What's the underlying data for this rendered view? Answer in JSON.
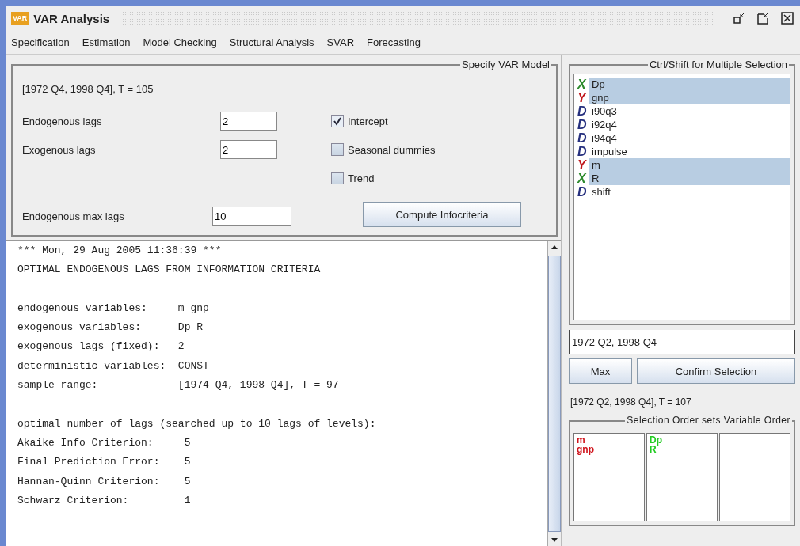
{
  "window": {
    "title": "VAR Analysis",
    "logo": "VAR"
  },
  "menu": [
    {
      "label": "Specification",
      "underlined_first": true
    },
    {
      "label": "Estimation",
      "underlined_first": true
    },
    {
      "label": "Model Checking",
      "underlined_first": true
    },
    {
      "label": "Structural Analysis",
      "underlined_first": false
    },
    {
      "label": "SVAR",
      "underlined_first": false
    },
    {
      "label": "Forecasting",
      "underlined_first": false
    }
  ],
  "spec": {
    "title": "Specify VAR Model",
    "range": "[1972 Q4, 1998 Q4], T = 105",
    "fields": [
      {
        "label": "Endogenous lags",
        "value": "2"
      },
      {
        "label": "Exogenous lags",
        "value": "2"
      },
      {
        "label": "Endogenous max lags",
        "value": "10"
      }
    ],
    "checkboxes": [
      {
        "label": "Intercept",
        "checked": true
      },
      {
        "label": "Seasonal dummies",
        "checked": false
      },
      {
        "label": "Trend",
        "checked": false
      }
    ],
    "button": "Compute Infocriteria"
  },
  "output": [
    [
      "*** Mon, 29 Aug 2005 11:36:39 ***",
      "OPTIMAL ENDOGENOUS LAGS FROM INFORMATION CRITERIA"
    ],
    [
      "endogenous variables:     m gnp",
      "exogenous variables:      Dp R",
      "exogenous lags (fixed):   2",
      "deterministic variables:  CONST",
      "sample range:             [1974 Q4, 1998 Q4], T = 97"
    ],
    [
      "optimal number of lags (searched up to 10 lags of levels):",
      "Akaike Info Criterion:     5",
      "Final Prediction Error:    5",
      "Hannan-Quinn Criterion:    5",
      "Schwarz Criterion:         1"
    ]
  ],
  "variables": {
    "title": "Ctrl/Shift for Multiple Selection",
    "items": [
      {
        "type": "X",
        "color": "#2e8b2e",
        "name": "Dp",
        "selected": true
      },
      {
        "type": "Y",
        "color": "#c0161b",
        "name": "gnp",
        "selected": true
      },
      {
        "type": "D",
        "color": "#26307e",
        "name": "i90q3",
        "selected": false
      },
      {
        "type": "D",
        "color": "#26307e",
        "name": "i92q4",
        "selected": false
      },
      {
        "type": "D",
        "color": "#26307e",
        "name": "i94q4",
        "selected": false
      },
      {
        "type": "D",
        "color": "#26307e",
        "name": "impulse",
        "selected": false
      },
      {
        "type": "Y",
        "color": "#c0161b",
        "name": "m",
        "selected": true
      },
      {
        "type": "X",
        "color": "#2e8b2e",
        "name": "R",
        "selected": true
      },
      {
        "type": "D",
        "color": "#26307e",
        "name": "shift",
        "selected": false
      }
    ]
  },
  "sample": {
    "value": "1972 Q2, 1998 Q4",
    "max_button": "Max",
    "confirm_button": "Confirm Selection",
    "range": "[1972 Q2, 1998 Q4], T = 107"
  },
  "order": {
    "title": "Selection Order sets Variable Order",
    "columns": [
      {
        "color": "#d0141c",
        "items": [
          "m",
          "gnp"
        ]
      },
      {
        "color": "#22cc22",
        "items": [
          "Dp",
          "R"
        ]
      },
      {}
    ]
  }
}
